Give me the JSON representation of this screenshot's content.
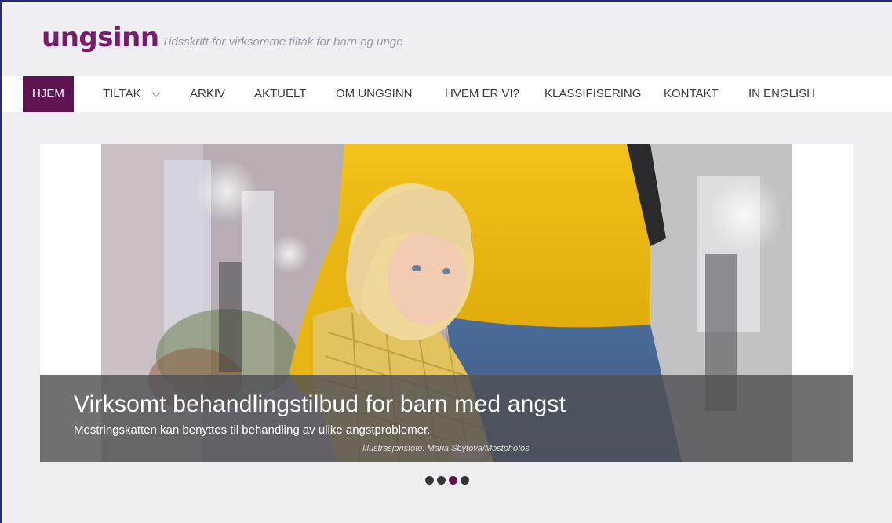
{
  "header": {
    "logo_text": "ungsinn",
    "tagline": "Tidsskrift for virksomme tiltak for barn og unge"
  },
  "nav": {
    "items": [
      {
        "label": "HJEM",
        "active": true
      },
      {
        "label": "TILTAK",
        "has_dropdown": true
      },
      {
        "label": "ARKIV"
      },
      {
        "label": "AKTUELT"
      },
      {
        "label": "OM UNGSINN"
      },
      {
        "label": "HVEM ER VI?"
      },
      {
        "label": "KLASSIFISERING"
      },
      {
        "label": "KONTAKT"
      },
      {
        "label": "IN ENGLISH"
      }
    ]
  },
  "slider": {
    "title": "Virksomt behandlingstilbud for barn med angst",
    "subtitle": "Mestringskatten kan benyttes til behandling av ulike angstproblemer.",
    "credit": "Illustrasjonsfoto: Maria Sbytova/Mostphotos",
    "active_dot": 3,
    "dot_count": 4
  },
  "colors": {
    "brand": "#7a1a6a",
    "nav_active_bg": "#5e1450",
    "page_bg": "#efeff3"
  }
}
